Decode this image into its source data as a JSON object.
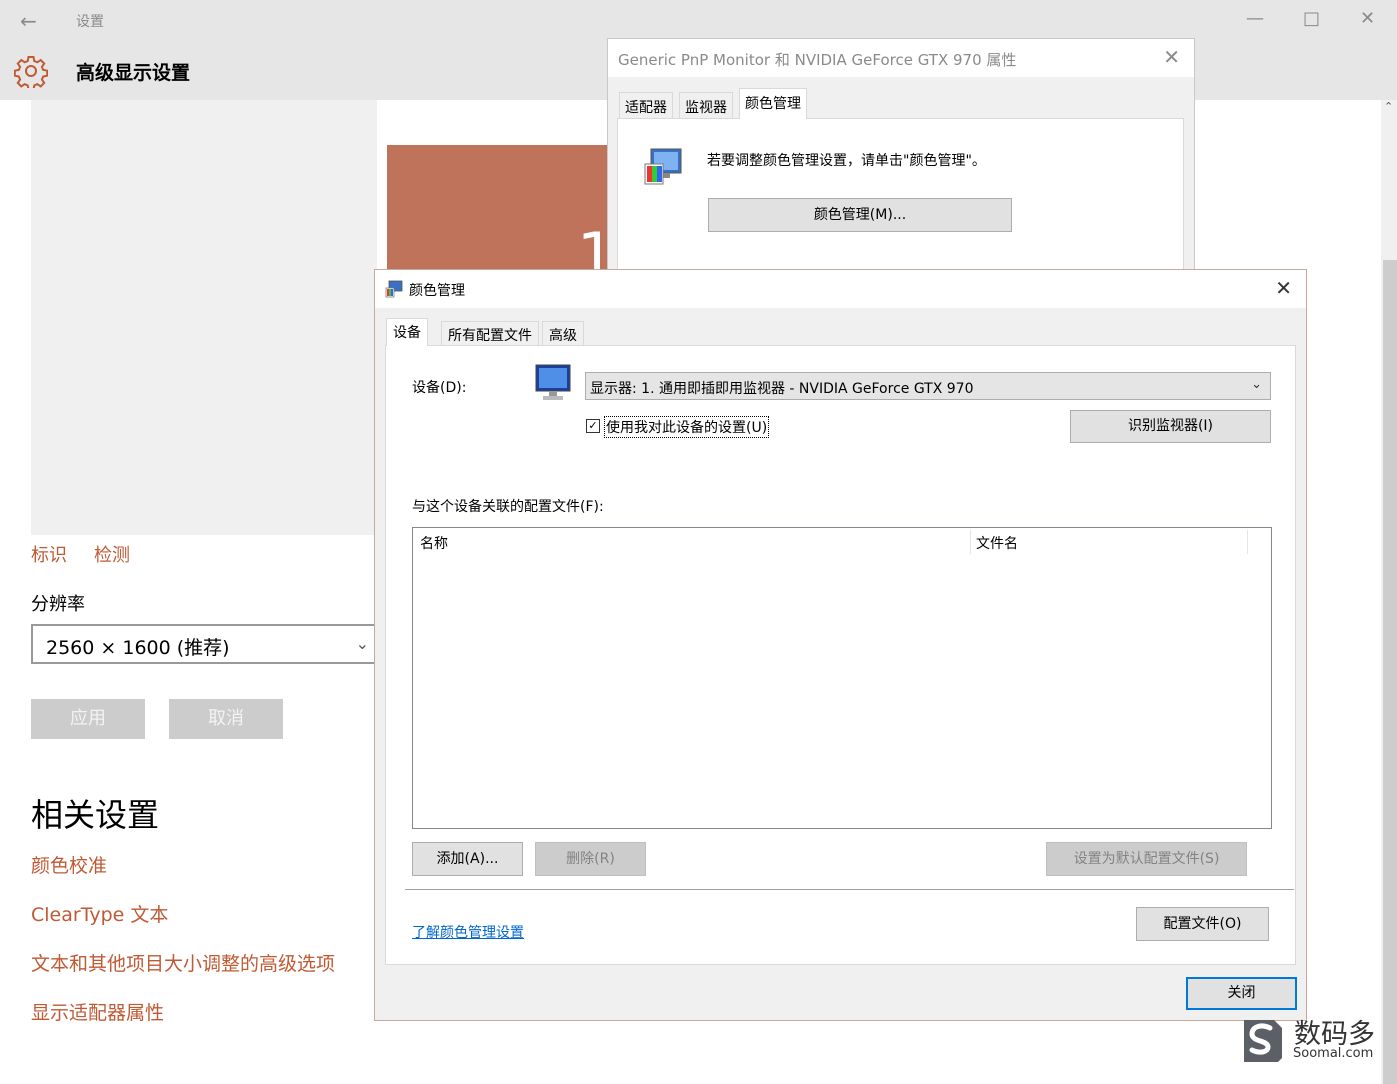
{
  "settings": {
    "window_caption": "设置",
    "page_title": "高级显示设置",
    "monitor_number": "1",
    "links": {
      "identify": "标识",
      "detect": "检测"
    },
    "resolution_label": "分辨率",
    "resolution_value": "2560 × 1600 (推荐)",
    "apply_label": "应用",
    "cancel_label": "取消",
    "related_title": "相关设置",
    "related_links": [
      "颜色校准",
      "ClearType 文本",
      "文本和其他项目大小调整的高级选项",
      "显示适配器属性"
    ]
  },
  "properties_dialog": {
    "title": "Generic PnP Monitor 和 NVIDIA GeForce GTX 970 属性",
    "tabs": [
      "适配器",
      "监视器",
      "颜色管理"
    ],
    "active_tab": 2,
    "message": "若要调整颜色管理设置，请单击\"颜色管理\"。",
    "color_mgmt_button": "颜色管理(M)..."
  },
  "color_dialog": {
    "title": "颜色管理",
    "tabs": [
      "设备",
      "所有配置文件",
      "高级"
    ],
    "active_tab": 0,
    "device_label": "设备(D):",
    "device_value": "显示器: 1. 通用即插即用监视器 - NVIDIA GeForce GTX 970",
    "use_my_settings_label": "使用我对此设备的设置(U)",
    "use_my_settings_checked": true,
    "identify_button": "识别监视器(I)",
    "profiles_label": "与这个设备关联的配置文件(F):",
    "columns": [
      "名称",
      "文件名"
    ],
    "add_button": "添加(A)...",
    "remove_button": "删除(R)",
    "set_default_button": "设置为默认配置文件(S)",
    "profiles_button": "配置文件(O)",
    "learn_link": "了解颜色管理设置",
    "close_button": "关闭"
  },
  "watermark": {
    "name": "数码多",
    "domain": "Soomal.com"
  },
  "colors": {
    "accent_link": "#c05a35",
    "monitor_tile": "#c0735b",
    "focus_blue": "#0078d7"
  }
}
